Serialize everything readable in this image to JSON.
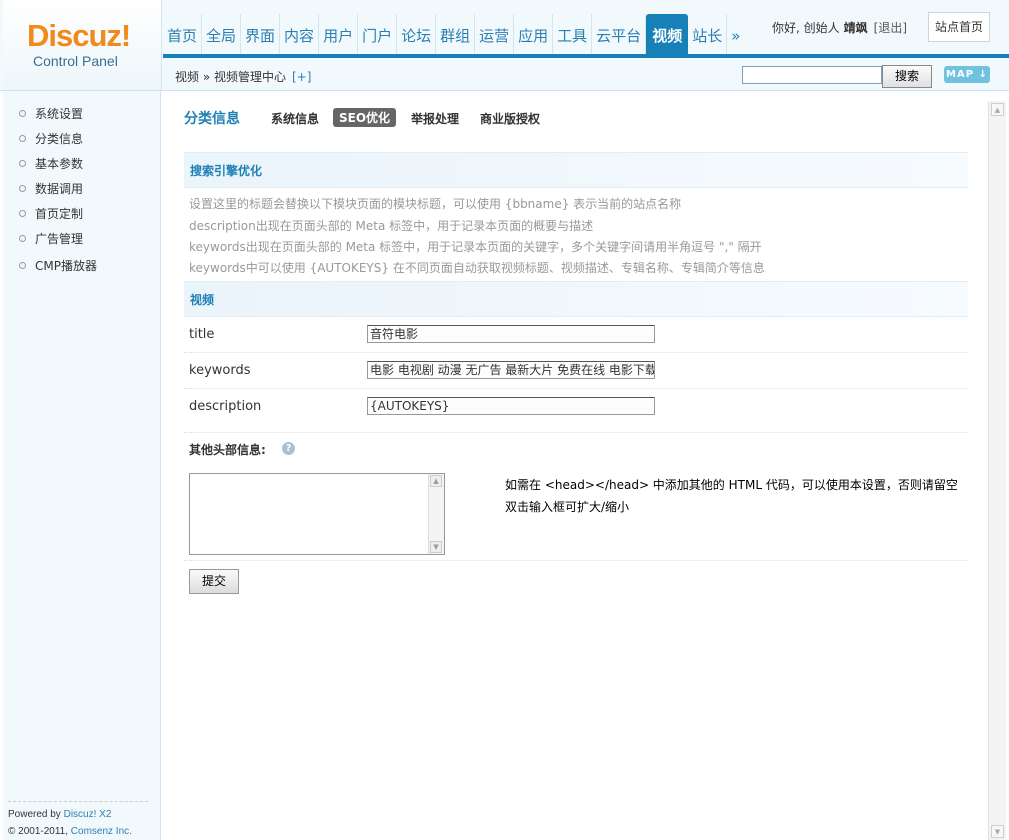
{
  "logo": {
    "brand": "Discuz!",
    "subtitle": "Control Panel"
  },
  "nav": {
    "items": [
      "首页",
      "全局",
      "界面",
      "内容",
      "用户",
      "门户",
      "论坛",
      "群组",
      "运营",
      "应用",
      "工具",
      "云平台",
      "视频",
      "站长",
      "»"
    ],
    "active_index": 12
  },
  "user": {
    "greeting": "你好, 创始人",
    "name": "靖飒",
    "logout": "[退出]",
    "site_home": "站点首页"
  },
  "breadcrumb": {
    "path": "视频 » 视频管理中心",
    "add": "[+]"
  },
  "search": {
    "value": "",
    "button": "搜索",
    "map": "MAP"
  },
  "sidebar": {
    "items": [
      "系统设置",
      "分类信息",
      "基本参数",
      "数据调用",
      "首页定制",
      "广告管理",
      "CMP播放器"
    ],
    "footer": {
      "powered_prefix": "Powered by",
      "powered_link": "Discuz! X2",
      "copyright_prefix": "© 2001-2011,",
      "copyright_link": "Comsenz Inc."
    }
  },
  "main": {
    "title": "分类信息",
    "tabs": [
      "系统信息",
      "SEO优化",
      "举报处理",
      "商业版授权"
    ],
    "active_tab": 1,
    "section_seo": "搜索引擎优化",
    "tips": [
      "设置这里的标题会替换以下模块页面的模块标题，可以使用 {bbname} 表示当前的站点名称",
      "description出现在页面头部的 Meta 标签中，用于记录本页面的概要与描述",
      "keywords出现在页面头部的 Meta 标签中，用于记录本页面的关键字，多个关键字间请用半角逗号 \",\" 隔开",
      "keywords中可以使用 {AUTOKEYS} 在不同页面自动获取视频标题、视频描述、专辑名称、专辑简介等信息"
    ],
    "section_video": "视频",
    "fields": [
      {
        "label": "title",
        "value": "音符电影"
      },
      {
        "label": "keywords",
        "value": "电影 电视剧 动漫 无广告 最新大片 免费在线 电影下载"
      },
      {
        "label": "description",
        "value": "{AUTOKEYS}"
      }
    ],
    "extra_head": {
      "label": "其他头部信息:",
      "value": "",
      "help_lines": [
        "如需在 <head></head> 中添加其他的 HTML 代码，可以使用本设置，否则请留空",
        "双击输入框可扩大/缩小"
      ]
    },
    "submit": "提交"
  },
  "colors": {
    "accent": "#1780b6",
    "logo_orange": "#f08a1a",
    "link": "#2a7fb0"
  }
}
